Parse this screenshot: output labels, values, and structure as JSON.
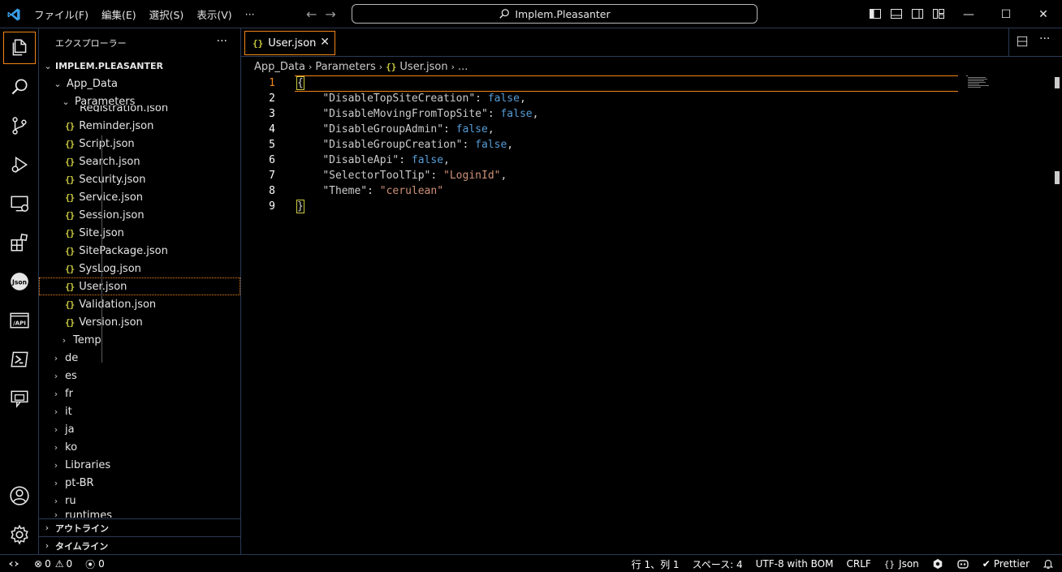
{
  "titlebar": {
    "menu": [
      "ファイル(F)",
      "編集(E)",
      "選択(S)",
      "表示(V)",
      "···"
    ],
    "search_text": "Implem.Pleasanter",
    "back_arrow": "←",
    "forward_arrow": "→",
    "window_controls": {
      "minimize": "—",
      "maximize": "☐",
      "close": "✕"
    }
  },
  "activity_bar": {
    "icons": [
      "explorer-icon",
      "search-icon",
      "source-control-icon",
      "run-debug-icon",
      "remote-explorer-icon",
      "extensions-icon",
      "json-icon",
      "api-icon",
      "powershell-icon",
      "chat-icon",
      "account-icon",
      "settings-gear-icon"
    ],
    "json_label": "Json",
    "api_label": "/API"
  },
  "sidebar": {
    "title": "エクスプローラー",
    "more": "···",
    "root": "IMPLEM.PLEASANTER",
    "folders": {
      "app_data": "App_Data",
      "parameters": "Parameters",
      "partial": "Registration.json"
    },
    "files": [
      "Reminder.json",
      "Script.json",
      "Search.json",
      "Security.json",
      "Service.json",
      "Session.json",
      "Site.json",
      "SitePackage.json",
      "SysLog.json",
      "User.json",
      "Validation.json",
      "Version.json"
    ],
    "folders_after": [
      "Temp"
    ],
    "top_folders": [
      "de",
      "es",
      "fr",
      "it",
      "ja",
      "ko",
      "Libraries",
      "pt-BR",
      "ru",
      "runtimes"
    ],
    "outline": "アウトライン",
    "timeline": "タイムライン"
  },
  "editor": {
    "tab_label": "User.json",
    "tab_close": "✕",
    "tab_more": "···",
    "breadcrumb": [
      "App_Data",
      "Parameters",
      "User.json",
      "..."
    ],
    "json_glyph": "{}",
    "lines": [
      {
        "no": "1",
        "key": "",
        "val": "",
        "text": "{"
      },
      {
        "no": "2",
        "key": "\"DisableTopSiteCreation\"",
        "val": "false",
        "type": "bool"
      },
      {
        "no": "3",
        "key": "\"DisableMovingFromTopSite\"",
        "val": "false",
        "type": "bool"
      },
      {
        "no": "4",
        "key": "\"DisableGroupAdmin\"",
        "val": "false",
        "type": "bool"
      },
      {
        "no": "5",
        "key": "\"DisableGroupCreation\"",
        "val": "false",
        "type": "bool"
      },
      {
        "no": "6",
        "key": "\"DisableApi\"",
        "val": "false",
        "type": "bool"
      },
      {
        "no": "7",
        "key": "\"SelectorToolTip\"",
        "val": "\"LoginId\"",
        "type": "str"
      },
      {
        "no": "8",
        "key": "\"Theme\"",
        "val": "\"cerulean\"",
        "type": "str",
        "last": true
      },
      {
        "no": "9",
        "key": "",
        "val": "",
        "text": "}"
      }
    ]
  },
  "statusbar": {
    "errors": "0",
    "warnings": "0",
    "ports": "0",
    "position": "行 1、列 1",
    "spaces": "スペース: 4",
    "encoding": "UTF-8 with BOM",
    "eol": "CRLF",
    "language": "Json",
    "formatter": "Prettier"
  },
  "colors": {
    "accent_border": "#f38518",
    "json_icon": "#cbcb41",
    "boolean": "#569cd6",
    "string": "#ce9178",
    "contrast_border": "#2b3a55"
  }
}
